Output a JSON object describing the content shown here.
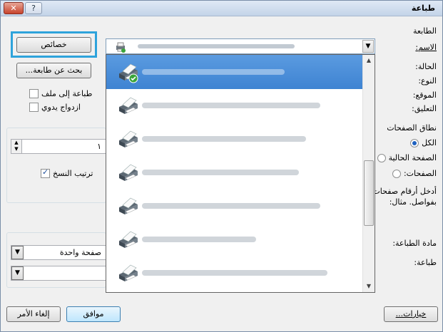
{
  "window": {
    "title": "طباعة",
    "help_label": "?",
    "close_label": "✕"
  },
  "printer": {
    "section_label": "الطابعة",
    "name_label": "الاسم:",
    "status_label": "الحالة:",
    "type_label": "النوع:",
    "location_label": "الموقع:",
    "comment_label": "التعليق:",
    "properties_button": "خصائص",
    "find_printer_button": "بحث عن طابعة...",
    "print_to_file_label": "طباعة إلى ملف",
    "manual_duplex_label": "ازدواج يدوي",
    "print_to_file_checked": false,
    "manual_duplex_checked": false
  },
  "page_range": {
    "section_label": "نطاق الصفحات",
    "all_label": "الكل",
    "current_page_label": "الصفحة الحالية",
    "pages_label": "الصفحات:",
    "hint_line1": "أدخل أرقام صفحات",
    "hint_line2": "بفواصل. مثال:",
    "selected": "all"
  },
  "copies": {
    "count_value": "١",
    "collate_label": "ترتيب النسخ",
    "collate_checked": true
  },
  "print_what": {
    "label": "مادة الطباعة:",
    "print_label": "طباعة:"
  },
  "zoom": {
    "pages_per_sheet_value": "صفحة واحدة",
    "scale_value": ""
  },
  "footer": {
    "options_button": "خيارات...",
    "ok_button": "موافق",
    "cancel_button": "إلغاء الأمر"
  },
  "colors": {
    "selection": "#3e83d2",
    "highlight_box": "#2ea3db",
    "ready_badge": "#3aa43a"
  },
  "printer_list_icons": [
    "printer-icon"
  ]
}
